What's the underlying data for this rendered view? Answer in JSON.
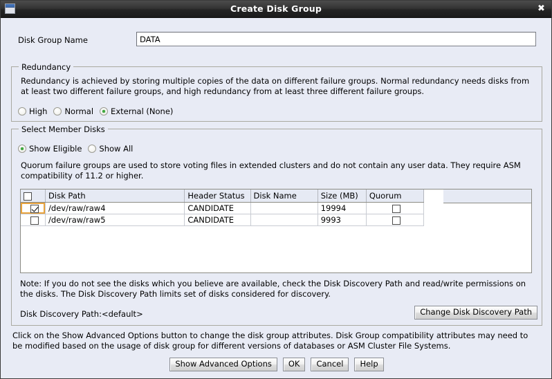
{
  "window": {
    "title": "Create Disk Group",
    "icon": "window-icon",
    "close_label": "✖"
  },
  "form": {
    "disk_group_name_label": "Disk Group Name",
    "disk_group_name_value": "DATA",
    "disk_group_name_placeholder": ""
  },
  "redundancy": {
    "legend": "Redundancy",
    "description": "Redundancy is achieved by storing multiple copies of the data on different failure groups. Normal redundancy needs disks from at least two different failure groups, and high redundancy from at least three different failure groups.",
    "options": [
      {
        "label": "High",
        "selected": false
      },
      {
        "label": "Normal",
        "selected": false
      },
      {
        "label": "External (None)",
        "selected": true
      }
    ]
  },
  "members": {
    "legend": "Select Member Disks",
    "filters": [
      {
        "label": "Show Eligible",
        "selected": true
      },
      {
        "label": "Show All",
        "selected": false
      }
    ],
    "description": "Quorum failure groups are used to store voting files in extended clusters and do not contain any user data. They require ASM compatibility of 11.2 or higher.",
    "table": {
      "columns": [
        "",
        "Disk Path",
        "Header Status",
        "Disk Name",
        "Size (MB)",
        "Quorum"
      ],
      "header_select_all": false,
      "rows": [
        {
          "selected": true,
          "focused": true,
          "disk_path": "/dev/raw/raw4",
          "header_status": "CANDIDATE",
          "disk_name": "",
          "size_mb": "19994",
          "quorum": false
        },
        {
          "selected": false,
          "focused": false,
          "disk_path": "/dev/raw/raw5",
          "header_status": "CANDIDATE",
          "disk_name": "",
          "size_mb": "9993",
          "quorum": false
        }
      ]
    },
    "note": "Note: If you do not see the disks which you believe are available, check the Disk Discovery Path and read/write permissions on the disks. The Disk Discovery Path limits set of disks considered for discovery.",
    "discovery_path_text": "Disk Discovery Path:<default>",
    "change_discovery_path_button": "Change Disk Discovery Path"
  },
  "footer": {
    "description": "Click on the Show Advanced Options button to change the disk group attributes. Disk Group compatibility attributes may need to be modified based on the usage of disk group for different versions of databases or ASM Cluster File Systems.",
    "buttons": [
      {
        "label": "Show Advanced Options",
        "name": "show-advanced-options-button"
      },
      {
        "label": "OK",
        "name": "ok-button"
      },
      {
        "label": "Cancel",
        "name": "cancel-button"
      },
      {
        "label": "Help",
        "name": "help-button"
      }
    ]
  },
  "colors": {
    "dialog_background": "#e8ebf5",
    "titlebar": "#2a2a2a",
    "selected_radio_dot": "#3faa3f",
    "focus_ring": "#e8a33d",
    "table_header": "#e6eaf4"
  }
}
